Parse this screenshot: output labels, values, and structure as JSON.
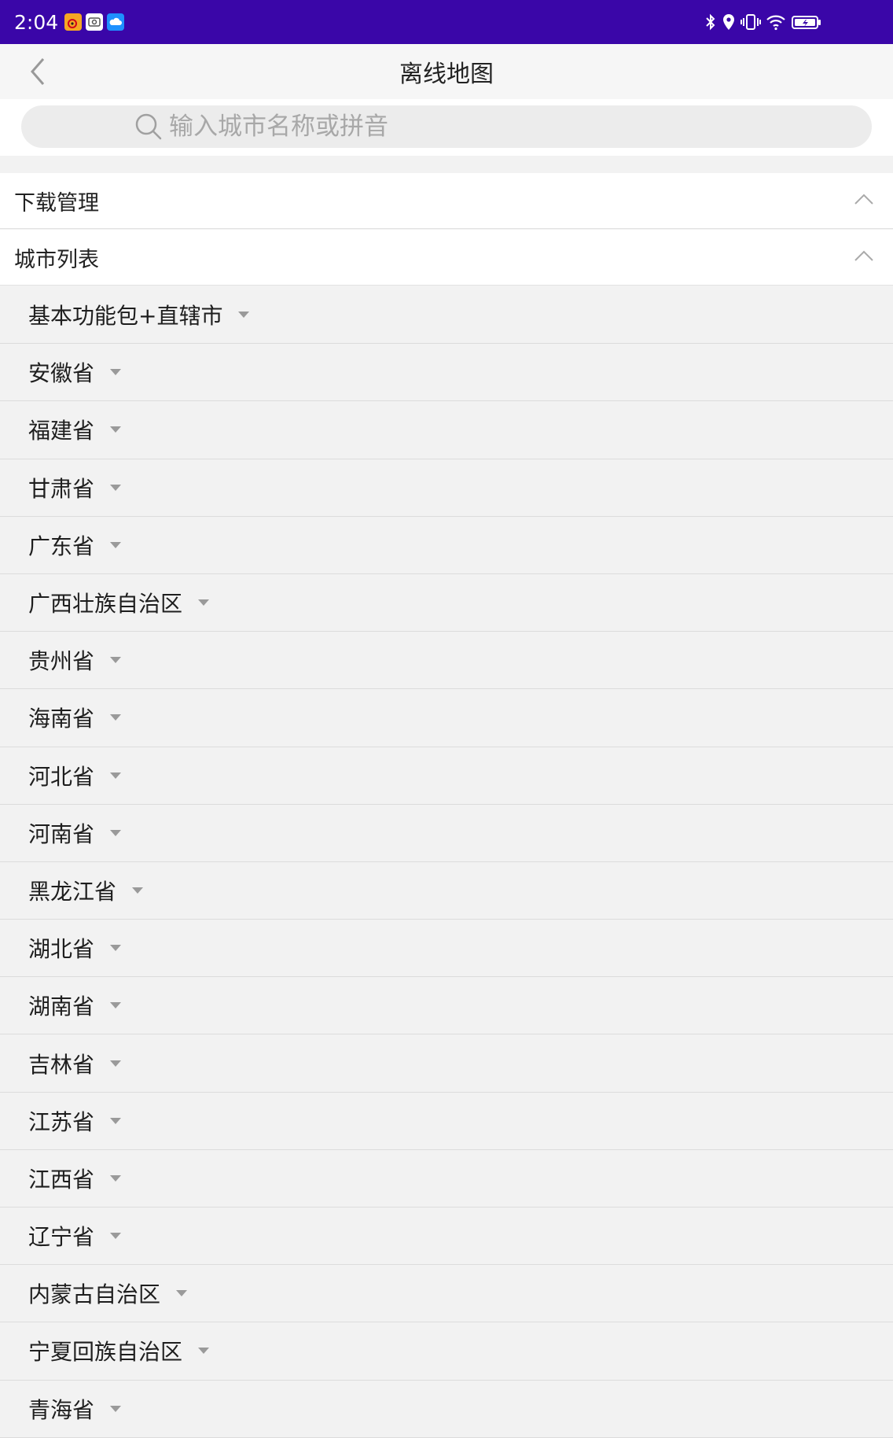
{
  "status_bar": {
    "time": "2:04",
    "notification_icons": [
      "weibo-icon",
      "app-icon",
      "cloud-icon"
    ],
    "status_icons": [
      "bluetooth-icon",
      "location-icon",
      "vibrate-icon",
      "wifi-icon",
      "battery-icon"
    ],
    "background_color": "#3a06a8"
  },
  "nav": {
    "title": "离线地图",
    "back_icon": "chevron-left-icon"
  },
  "search": {
    "placeholder": "输入城市名称或拼音",
    "value": ""
  },
  "sections": {
    "download": {
      "label": "下载管理",
      "expanded": true
    },
    "city_list": {
      "label": "城市列表",
      "expanded": true
    }
  },
  "provinces": [
    "基本功能包+直辖市",
    "安徽省",
    "福建省",
    "甘肃省",
    "广东省",
    "广西壮族自治区",
    "贵州省",
    "海南省",
    "河北省",
    "河南省",
    "黑龙江省",
    "湖北省",
    "湖南省",
    "吉林省",
    "江苏省",
    "江西省",
    "辽宁省",
    "内蒙古自治区",
    "宁夏回族自治区",
    "青海省"
  ]
}
